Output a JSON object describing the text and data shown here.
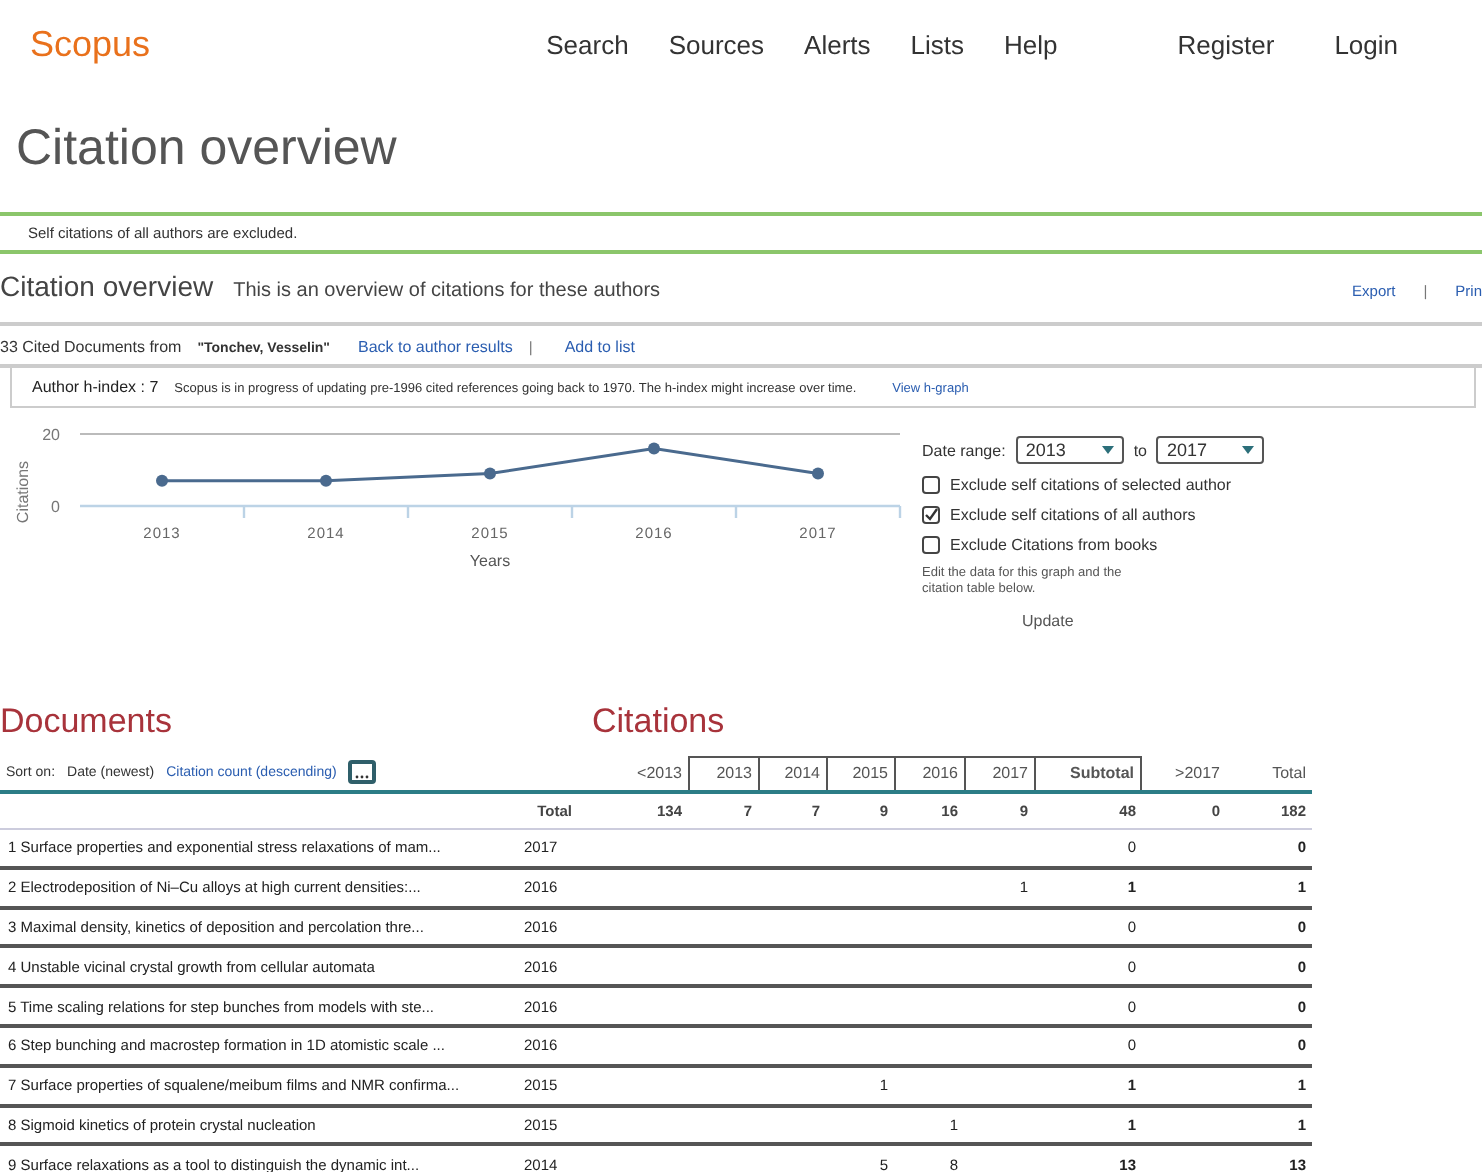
{
  "header": {
    "logo": "Scopus",
    "nav": [
      "Search",
      "Sources",
      "Alerts",
      "Lists",
      "Help"
    ],
    "account": [
      "Register",
      "Login"
    ]
  },
  "page_title": "Citation overview",
  "notice": "Self citations of all authors are excluded.",
  "overview": {
    "title": "Citation overview",
    "subtitle": "This is an overview of citations for these authors",
    "actions": [
      "Export",
      "Prin"
    ],
    "separator": "|"
  },
  "cited_line": {
    "text": "33 Cited Documents from",
    "author": "\"Tonchev, Vesselin\"",
    "links": [
      "Back to author results",
      "Add to list"
    ],
    "separator": "|"
  },
  "hindex": {
    "label": "Author h-index : 7",
    "note": "Scopus is in progress of updating pre-1996 cited references going back to 1970. The h-index might increase over time.",
    "link": "View h-graph"
  },
  "chart_data": {
    "type": "line",
    "xlabel": "Years",
    "ylabel": "Citations",
    "categories": [
      "2013",
      "2014",
      "2015",
      "2016",
      "2017"
    ],
    "series": [
      {
        "color": "#4a6a8e",
        "marker": "circle",
        "values": [
          7,
          7,
          9,
          16,
          9
        ]
      }
    ],
    "ylim": [
      0,
      20
    ],
    "yticks": [
      0,
      20
    ]
  },
  "filters": {
    "date_label": "Date range:",
    "from": "2013",
    "to_label": "to",
    "to": "2017",
    "options": [
      {
        "label": "Exclude self citations of selected author",
        "checked": false
      },
      {
        "label": "Exclude self citations of all authors",
        "checked": true
      },
      {
        "label": "Exclude Citations from books",
        "checked": false
      }
    ],
    "hint": "Edit the data for this graph and the citation table below.",
    "update": "Update"
  },
  "documents_heading": "Documents",
  "citations_heading": "Citations",
  "sort": {
    "label": "Sort on:",
    "options": [
      {
        "label": "Date (newest)",
        "selected": true
      },
      {
        "label": "Citation count (descending)",
        "selected": false
      }
    ]
  },
  "columns": [
    {
      "label": "<2013",
      "boxed": false
    },
    {
      "label": "2013",
      "boxed": true
    },
    {
      "label": "2014",
      "boxed": true
    },
    {
      "label": "2015",
      "boxed": true
    },
    {
      "label": "2016",
      "boxed": true
    },
    {
      "label": "2017",
      "boxed": true
    },
    {
      "label": "Subtotal",
      "boxed": true
    },
    {
      "label": ">2017",
      "boxed": false
    },
    {
      "label": "Total",
      "boxed": false
    }
  ],
  "totals": {
    "label": "Total",
    "values": [
      "134",
      "7",
      "7",
      "9",
      "16",
      "9",
      "48",
      "0",
      "182"
    ]
  },
  "rows": [
    {
      "number": "1",
      "title": "Surface properties and exponential stress relaxations of mam...",
      "year": "2017",
      "cells": [
        null,
        null,
        null,
        null,
        null,
        null,
        "0",
        null,
        "0"
      ]
    },
    {
      "number": "2",
      "title": "Electrodeposition of Ni–Cu alloys at high current densities:...",
      "year": "2016",
      "cells": [
        null,
        null,
        null,
        null,
        null,
        "1",
        "1",
        null,
        "1"
      ]
    },
    {
      "number": "3",
      "title": "Maximal density, kinetics of deposition and percolation thre...",
      "year": "2016",
      "cells": [
        null,
        null,
        null,
        null,
        null,
        null,
        "0",
        null,
        "0"
      ]
    },
    {
      "number": "4",
      "title": "Unstable vicinal crystal growth from cellular automata",
      "year": "2016",
      "cells": [
        null,
        null,
        null,
        null,
        null,
        null,
        "0",
        null,
        "0"
      ]
    },
    {
      "number": "5",
      "title": "Time scaling relations for step bunches from models with ste...",
      "year": "2016",
      "cells": [
        null,
        null,
        null,
        null,
        null,
        null,
        "0",
        null,
        "0"
      ]
    },
    {
      "number": "6",
      "title": "Step bunching and macrostep formation in 1D atomistic scale ...",
      "year": "2016",
      "cells": [
        null,
        null,
        null,
        null,
        null,
        null,
        "0",
        null,
        "0"
      ]
    },
    {
      "number": "7",
      "title": "Surface properties of squalene/meibum films and NMR confirma...",
      "year": "2015",
      "cells": [
        null,
        null,
        null,
        "1",
        null,
        null,
        "1",
        null,
        "1"
      ]
    },
    {
      "number": "8",
      "title": "Sigmoid kinetics of protein crystal nucleation",
      "year": "2015",
      "cells": [
        null,
        null,
        null,
        null,
        "1",
        null,
        "1",
        null,
        "1"
      ]
    },
    {
      "number": "9",
      "title": "Surface relaxations as a tool to distinguish the dynamic int...",
      "year": "2014",
      "cells": [
        null,
        null,
        null,
        "5",
        "8",
        null,
        "13",
        null,
        "13"
      ]
    }
  ]
}
